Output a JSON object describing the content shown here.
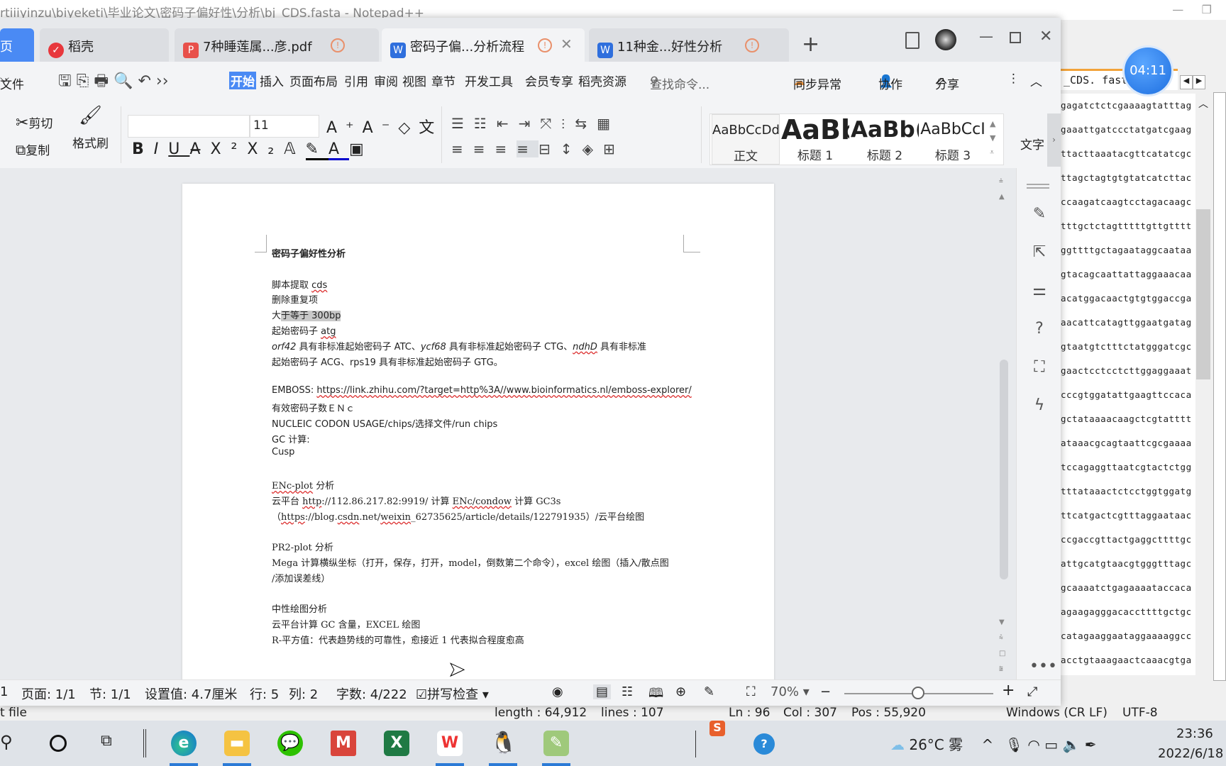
{
  "notepad": {
    "title": "rtiiiyinzu\\biyeketi\\毕业论文\\密码子偏好性\\分析\\bj_CDS.fasta - Notepad++",
    "tab": "_CDS. fasta",
    "lines": [
      "gagatctctcgaaaagtatttag",
      "gaaattgatccctatgatcgaag",
      "ttacttaaatacgttcatatcgc",
      "ttagctagtgtgtatcatcttac",
      "ccaagatcaagtcctagacaagc",
      "tttgctctagtttttgttgtttt",
      "ggttttgctagaataggcaataa",
      "gtacagcaattattaggaaacaa",
      "acatggacaactgtgtggaccga",
      "aacattcatagttggaatgatag",
      "gtaatgtctttctatgggatcgc",
      "gaactcctcctcttggaggaaat",
      "cccgtggatattgaagttccaca",
      "gctataaaacaagctcgtatttt",
      "ataaacgcagtaattcgcgaaaa",
      "tccagaggttaatcgtactctgg",
      "tttataaactctcctggtggatg",
      "ttcatgactcgtttaggaataac",
      "ccgaccgttactgaggcttttgc",
      "attgcatgtaacgtgggtttagc",
      "gcaaaatctgagaaaataccaca",
      "agaagagggacaccttttgctgc",
      "catagaaggaataggaaaaggcc",
      "acctgtaaagaactcaaacgtga"
    ],
    "status": {
      "type": "t file",
      "length": "length : 64,912",
      "lines": "lines : 107",
      "ln": "Ln : 96",
      "col": "Col : 307",
      "pos": "Pos : 55,920",
      "eol": "Windows (CR LF)",
      "enc": "UTF-8"
    }
  },
  "timer": "04:11",
  "wps": {
    "tabs": [
      {
        "label": "页",
        "color": "#4a8af4"
      },
      {
        "label": "稻壳",
        "color": "#e8383d"
      },
      {
        "label": "7种睡莲属...彦.pdf",
        "color": "#e8504a"
      },
      {
        "label": "密码子偏...分析流程",
        "color": "#2f6fdd"
      },
      {
        "label": "11种金...好性分析",
        "color": "#2f6fdd"
      }
    ],
    "new_tab": "+",
    "menu": {
      "file": "文件",
      "items": [
        "开始",
        "插入",
        "页面布局",
        "引用",
        "审阅",
        "视图",
        "章节",
        "开发工具",
        "会员专享",
        "稻壳资源"
      ],
      "search": "查找命令...",
      "sync": "同步异常",
      "collab": "协作",
      "share": "分享"
    },
    "ribbon": {
      "cut": "剪切",
      "copy": "复制",
      "format_painter": "格式刷",
      "font_size": "11",
      "styles": [
        {
          "preview": "AaBbCcDd",
          "label": "正文"
        },
        {
          "preview": "AaBb",
          "label": "标题 1"
        },
        {
          "preview": "AaBb(",
          "label": "标题 2"
        },
        {
          "preview": "AaBbCcI",
          "label": "标题 3"
        }
      ],
      "text_tool": "文字"
    },
    "doc": [
      [
        {
          "t": "密码子偏好性分析",
          "b": 1
        }
      ],
      [],
      [
        {
          "t": "脚本提取 "
        },
        {
          "t": "cds",
          "u": 1
        }
      ],
      [
        {
          "t": "删除重复项"
        }
      ],
      [
        {
          "t": "大"
        },
        {
          "t": "于等于 300bp",
          "h": 1
        }
      ],
      [
        {
          "t": "起始密码子 "
        },
        {
          "t": "atg",
          "u": 1
        }
      ],
      [
        {
          "t": "orf42",
          "i": 1
        },
        {
          "t": " 具有非标准起始密码子 ATC、"
        },
        {
          "t": "ycf68",
          "i": 1
        },
        {
          "t": " 具有非标准起始密码子 CTG、"
        },
        {
          "t": "ndhD",
          "i": 1,
          "u": 1
        },
        {
          "t": " 具有非标准"
        }
      ],
      [
        {
          "t": "起始密码子 ACG、rps19 具有非标准起始密码子 GTG。"
        }
      ],
      [],
      [
        {
          "t": "EMBOSS: "
        },
        {
          "t": "https://link.zhihu.com/?target=http%3A//www.bioinformatics.nl/emboss-explorer/",
          "u": 1
        }
      ],
      [
        {
          "t": "有效密码子数ＥＮｃ"
        }
      ],
      [
        {
          "t": "NUCLEIC CODON USAGE/chips/选择文件/run chips"
        }
      ],
      [
        {
          "t": "GC 计算:"
        }
      ],
      [
        {
          "t": "Cusp"
        }
      ],
      [],
      [
        {
          "t": "ENc-plot",
          "u": 1
        },
        {
          "t": " 分析"
        }
      ],
      [
        {
          "t": "云平台  "
        },
        {
          "t": "http",
          "u": 1
        },
        {
          "t": "://112.86.217.82:9919/  计算 "
        },
        {
          "t": "ENc/condow",
          "u": 1
        },
        {
          "t": " 计算 GC3s"
        }
      ],
      [
        {
          "t": "（"
        },
        {
          "t": "https",
          "u": 1
        },
        {
          "t": "://blog."
        },
        {
          "t": "csdn",
          "u": 1
        },
        {
          "t": ".net/"
        },
        {
          "t": "weixin",
          "u": 1
        },
        {
          "t": "_62735625/article/details/122791935）/云平台绘图"
        }
      ],
      [],
      [
        {
          "t": "PR2-plot 分析"
        }
      ],
      [
        {
          "t": "Mega 计算横纵坐标（打开，保存，打开，model，倒数第二个命令），excel 绘图（插入/散点图"
        }
      ],
      [
        {
          "t": "/添加误差线）"
        }
      ],
      [],
      [
        {
          "t": "中性绘图分析"
        }
      ],
      [
        {
          "t": "云平台计算 GC 含量，EXCEL 绘图"
        }
      ],
      [
        {
          "t": "R-平方值：代表趋势线的可靠性，愈接近 1 代表拟合程度愈高"
        }
      ]
    ],
    "status": {
      "page_num": "1",
      "page": "页面: 1/1",
      "section": "节: 1/1",
      "setting": "设置值: 4.7厘米",
      "row": "行: 5",
      "col": "列: 2",
      "words": "字数: 4/222",
      "spell": "拼写检查",
      "zoom": "70%",
      "zoom_level": 70
    }
  },
  "taskbar": {
    "weather": "26°C 雾",
    "time": "23:36",
    "date": "2022/6/18"
  }
}
